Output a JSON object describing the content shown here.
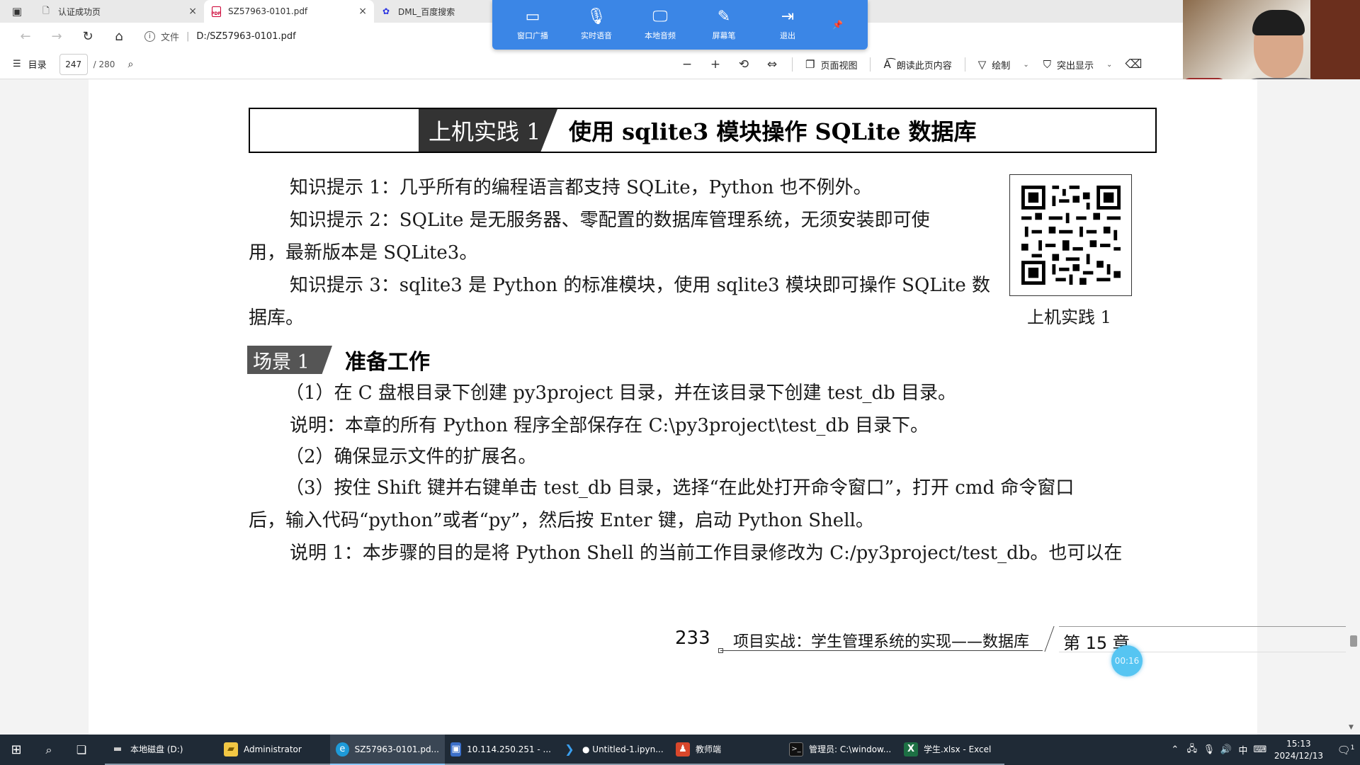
{
  "browser": {
    "tabs": [
      {
        "icon": "page-icon",
        "label": "认证成功页",
        "close": "×"
      },
      {
        "icon": "pdf-icon",
        "label": "SZ57963-0101.pdf",
        "close": "×"
      },
      {
        "icon": "baidu-paw-icon",
        "label": "DML_百度搜索"
      }
    ],
    "address": {
      "info_label": "文件",
      "url": "D:/SZ57963-0101.pdf"
    }
  },
  "pdf_toolbar": {
    "toc_label": "目录",
    "current_page": "247",
    "total_pages": "/ 280",
    "page_view_label": "页面视图",
    "read_aloud_label": "朗读此页内容",
    "draw_label": "绘制",
    "highlight_label": "突出显示"
  },
  "broadcast_toolbar": {
    "items": [
      {
        "icon": "screen-broadcast-icon",
        "label": "窗口广播"
      },
      {
        "icon": "microphone-icon",
        "label": "实时语音"
      },
      {
        "icon": "monitor-audio-icon",
        "label": "本地音频"
      },
      {
        "icon": "pen-icon",
        "label": "屏幕笔"
      },
      {
        "icon": "exit-icon",
        "label": "退出"
      }
    ]
  },
  "document": {
    "title_badge": "上机实践 1",
    "title_text": "使用 sqlite3 模块操作 SQLite 数据库",
    "tip1": "知识提示 1：几乎所有的编程语言都支持 SQLite，Python 也不例外。",
    "tip2_line1": "知识提示 2：SQLite 是无服务器、零配置的数据库管理系统，无须安装即可使",
    "tip2_line2": "用，最新版本是 SQLite3。",
    "tip3_line1": "知识提示 3：sqlite3 是 Python 的标准模块，使用 sqlite3 模块即可操作 SQLite 数",
    "tip3_line2": "据库。",
    "qr_caption": "上机实践 1",
    "scene_badge": "场景 1",
    "scene_title": "准备工作",
    "step1": "（1）在 C 盘根目录下创建 py3project 目录，并在该目录下创建 test_db 目录。",
    "note1": "说明：本章的所有 Python 程序全部保存在 C:\\py3project\\test_db 目录下。",
    "step2": "（2）确保显示文件的扩展名。",
    "step3_line1": "（3）按住 Shift 键并右键单击 test_db 目录，选择“在此处打开命令窗口”，打开 cmd 命令窗口",
    "step3_line2": "后，输入代码“python”或者“py”，然后按 Enter 键，启动 Python Shell。",
    "note2": "说明 1：本步骤的目的是将 Python Shell 的当前工作目录修改为 C:/py3project/test_db。也可以在",
    "footer_page": "233",
    "footer_text": "项目实战：学生管理系统的实现——数据库",
    "footer_chapter": "第 15 章",
    "timer": "00:16"
  },
  "taskbar": {
    "apps": [
      {
        "icon": "drive-icon",
        "label": "本地磁盘 (D:)"
      },
      {
        "icon": "folder-icon",
        "label": "Administrator"
      },
      {
        "icon": "edge-icon",
        "label": "SZ57963-0101.pd..."
      },
      {
        "icon": "remote-desktop-icon",
        "label": "10.114.250.251 - ..."
      },
      {
        "icon": "vscode-icon",
        "label": "● Untitled-1.ipyn..."
      },
      {
        "icon": "teacher-app-icon",
        "label": "教师端"
      },
      {
        "icon": "cmd-icon",
        "label": "管理员: C:\\window..."
      },
      {
        "icon": "excel-icon",
        "label": "学生.xlsx - Excel"
      }
    ],
    "ime": "中",
    "time": "15:13",
    "date": "2024/12/13",
    "notification_count": "1"
  }
}
